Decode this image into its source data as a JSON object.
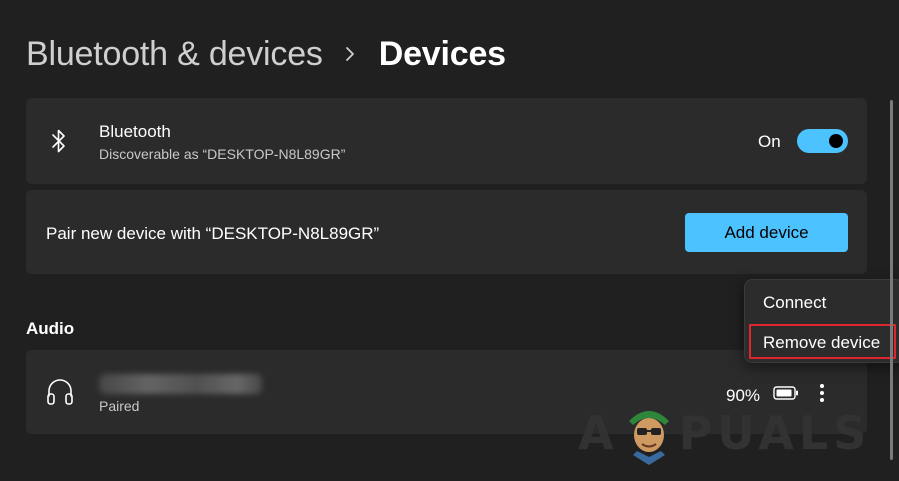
{
  "breadcrumb": {
    "parent": "Bluetooth & devices",
    "current": "Devices"
  },
  "bluetooth": {
    "icon": "bluetooth-icon",
    "title": "Bluetooth",
    "subtitle": "Discoverable as “DESKTOP-N8L89GR”",
    "toggle_label": "On",
    "toggle_on": true
  },
  "pair": {
    "label": "Pair new device with “DESKTOP-N8L89GR”",
    "button": "Add device"
  },
  "audio": {
    "section_title": "Audio",
    "devices": [
      {
        "icon": "headphones-icon",
        "status": "Paired",
        "battery": "90%"
      }
    ]
  },
  "context_menu": {
    "items": [
      "Connect",
      "Remove device"
    ],
    "highlighted": "Remove device"
  },
  "watermark": {
    "text_left": "A",
    "text_right": "PUALS"
  },
  "colors": {
    "background": "#202020",
    "card": "#2b2b2b",
    "accent": "#4cc2ff",
    "highlight": "#e0262c"
  }
}
